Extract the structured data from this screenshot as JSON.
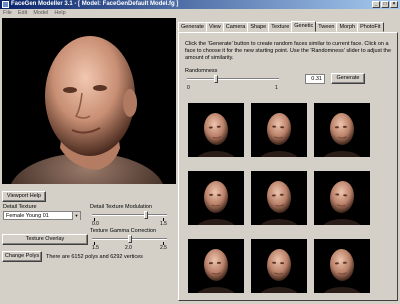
{
  "window": {
    "title": "FaceGen Modeller 3.1 - [ Model: FaceGenDefault Model.fg ]"
  },
  "menu": [
    "File",
    "Edit",
    "Model",
    "Help"
  ],
  "left": {
    "viewport_help": "Viewport Help",
    "detail_texture_label": "Detail Texture",
    "detail_texture_value": "Female Young 01",
    "detail_mod_label": "Detail Texture Modulation",
    "detail_mod_min": "0.0",
    "detail_mod_max": "1.5",
    "detail_mod_value": 0.73,
    "texture_overlay": "Texture Overlay",
    "gamma_label": "Texture Gamma Correction",
    "gamma_min": "1.5",
    "gamma_mid": "2.0",
    "gamma_max": "2.5",
    "gamma_value": 0.5,
    "change_polys": "Change Polys",
    "poly_info": "There are 6152 polys and 6292 vertices"
  },
  "tabs": [
    "Generate",
    "View",
    "Camera",
    "Shape",
    "Texture",
    "Genetic",
    "Tween",
    "Morph",
    "PhotoFit"
  ],
  "active_tab": "Genetic",
  "genetic": {
    "instructions": "Click the 'Generate' button to create random faces similar to current face.  Click on a face to choose it for the new starting point.  Use the 'Randomness' slider to adjust the amount of similarity.",
    "randomness_label": "Randomness",
    "randomness_value": "0.31",
    "randomness_min": "0",
    "randomness_max": "1",
    "generate_button": "Generate"
  }
}
